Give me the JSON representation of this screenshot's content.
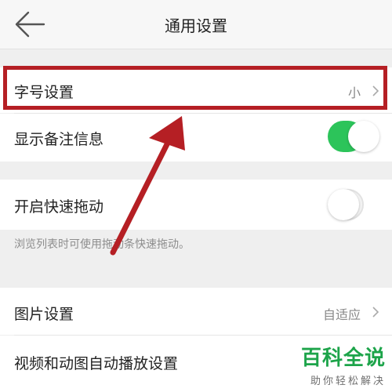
{
  "header": {
    "title": "通用设置",
    "back_icon": "back-arrow-icon"
  },
  "settings": {
    "font_size": {
      "label": "字号设置",
      "value": "小"
    },
    "show_notes": {
      "label": "显示备注信息",
      "enabled": true
    },
    "quick_drag": {
      "label": "开启快速拖动",
      "enabled": false,
      "hint": "浏览列表时可使用拖动条快速拖动。"
    },
    "image": {
      "label": "图片设置",
      "value": "自适应"
    },
    "video_autoplay": {
      "label": "视频和动图自动播放设置"
    }
  },
  "annotation": {
    "highlight_color": "#b51f24"
  },
  "watermark": {
    "main": "百科全说",
    "sub": "助你轻松解决"
  },
  "colors": {
    "toggle_on": "#2cc45a",
    "background": "#efefef"
  }
}
